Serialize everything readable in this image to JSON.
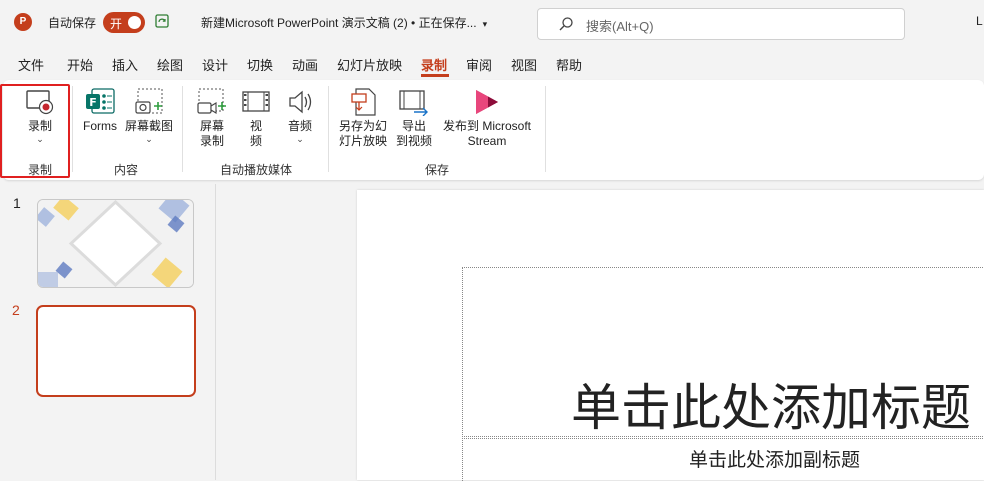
{
  "titlebar": {
    "app_logo": "P",
    "autosave_label": "自动保存",
    "autosave_state": "开",
    "doc_title": "新建Microsoft PowerPoint 演示文稿 (2) • 正在保存...",
    "search_placeholder": "搜索(Alt+Q)",
    "account_initial": "L"
  },
  "menu": {
    "tabs": [
      "文件",
      "开始",
      "插入",
      "绘图",
      "设计",
      "切换",
      "动画",
      "幻灯片放映",
      "录制",
      "审阅",
      "视图",
      "帮助"
    ],
    "active_tab": "录制"
  },
  "ribbon": {
    "groups": {
      "record": "录制",
      "content": "内容",
      "autoplay_media": "自动播放媒体",
      "save": "保存"
    },
    "buttons": {
      "record": "录制",
      "forms": "Forms",
      "screenshot": "屏幕截图",
      "screen_record_1": "屏幕",
      "screen_record_2": "录制",
      "video_1": "视",
      "video_2": "频",
      "audio": "音频",
      "save_as_show_1": "另存为幻",
      "save_as_show_2": "灯片放映",
      "export_video_1": "导出",
      "export_video_2": "到视频",
      "publish_stream_1": "发布到 Microsoft",
      "publish_stream_2": "Stream"
    }
  },
  "slides": {
    "numbers": [
      "1",
      "2"
    ],
    "title_placeholder": "单击此处添加标题",
    "subtitle_placeholder": "单击此处添加副标题"
  },
  "colors": {
    "accent": "#c43e1c",
    "highlight": "#e02020"
  }
}
